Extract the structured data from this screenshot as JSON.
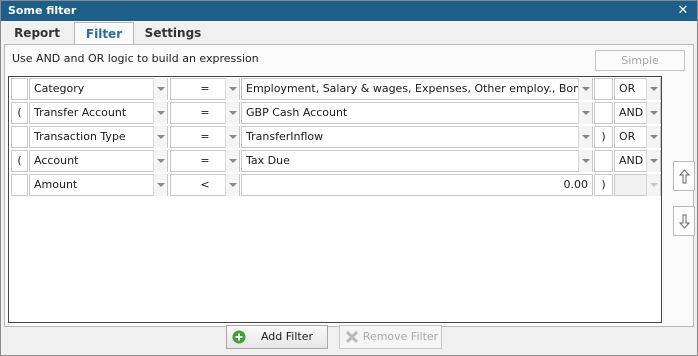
{
  "window": {
    "title": "Some filter",
    "close_glyph": "✕"
  },
  "tabs": [
    {
      "label": "Report",
      "active": false
    },
    {
      "label": "Filter",
      "active": true
    },
    {
      "label": "Settings",
      "active": false
    }
  ],
  "filter": {
    "hint": "Use AND and OR logic to build an expression",
    "simple_label": "Simple",
    "rows": [
      {
        "open": "",
        "field": "Category",
        "op": "=",
        "value": "Employment, Salary & wages, Expenses, Other employ., Bonuses, E",
        "close": "",
        "logic": "OR"
      },
      {
        "open": "(",
        "field": "Transfer Account",
        "op": "=",
        "value": "GBP Cash Account",
        "close": "",
        "logic": "AND"
      },
      {
        "open": "",
        "field": "Transaction Type",
        "op": "=",
        "value": "TransferInflow",
        "close": ")",
        "logic": "OR"
      },
      {
        "open": "(",
        "field": "Account",
        "op": "=",
        "value": "Tax Due",
        "close": "",
        "logic": "AND"
      },
      {
        "open": "",
        "field": "Amount",
        "op": "<",
        "value": "0.00",
        "close": ")",
        "logic": ""
      }
    ]
  },
  "side_buttons": {
    "up_icon": "arrow-up-icon",
    "down_icon": "arrow-down-icon"
  },
  "buttons": {
    "add_filter": "Add Filter",
    "remove_filter": "Remove Filter"
  },
  "colors": {
    "titlebar": "#1e5f8a",
    "active_tab_text": "#2b6d9c",
    "add_icon": "#3aa335"
  }
}
